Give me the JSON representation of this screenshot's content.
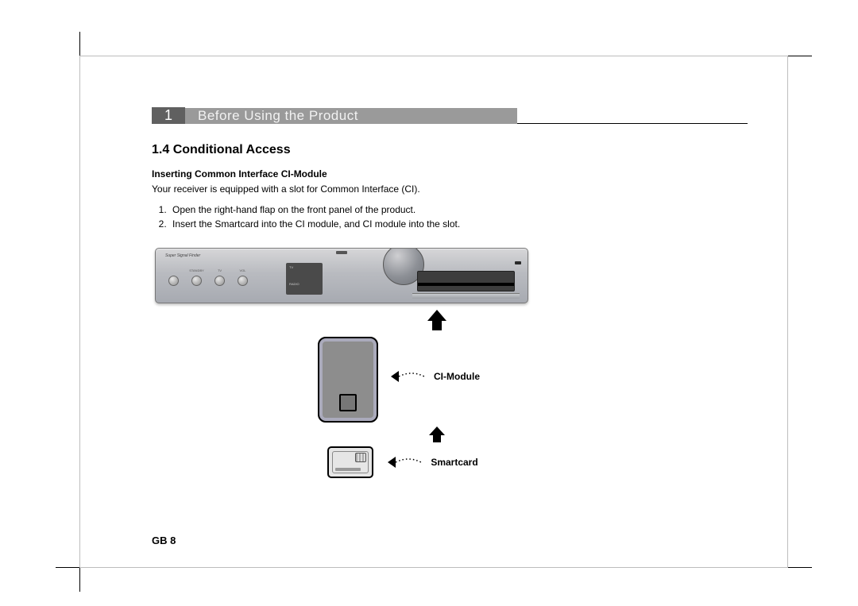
{
  "chapter": {
    "number": "1",
    "title": "Before Using the Product"
  },
  "section": {
    "number": "1.4",
    "title": "Conditional Access"
  },
  "subsection_title": "Inserting Common Interface CI-Module",
  "intro": "Your receiver is equipped with a slot for Common Interface (CI).",
  "steps": [
    "Open the right-hand flap on the front panel of the product.",
    "Insert the Smartcard into the CI module, and CI module into the slot."
  ],
  "diagram": {
    "receiver_brand": "Super Signal Finder",
    "knob_labels": [
      "",
      "STANDBY",
      "TV",
      "VOL"
    ],
    "mid_labels": [
      "TV",
      "RADIO"
    ],
    "ci_label": "CI-Module",
    "smartcard_label": "Smartcard"
  },
  "page_label": "GB 8"
}
